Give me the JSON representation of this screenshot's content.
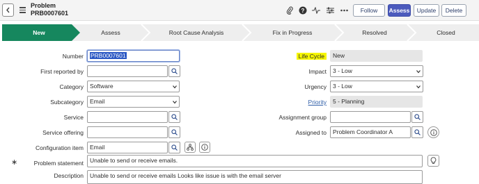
{
  "header": {
    "title": "Problem",
    "number": "PRB0007601",
    "buttons": {
      "follow": "Follow",
      "assess": "Assess",
      "update": "Update",
      "delete": "Delete"
    },
    "icons": [
      "paperclip-icon",
      "help-icon",
      "activity-icon",
      "settings-icon",
      "more-icon"
    ]
  },
  "flow": {
    "stages": [
      {
        "label": "New",
        "active": true
      },
      {
        "label": "Assess",
        "active": false
      },
      {
        "label": "Root Cause Analysis",
        "active": false
      },
      {
        "label": "Fix in Progress",
        "active": false
      },
      {
        "label": "Resolved",
        "active": false
      },
      {
        "label": "Closed",
        "active": false
      }
    ],
    "active_color": "#16875e"
  },
  "form": {
    "number": {
      "label": "Number",
      "value": "PRB0007601"
    },
    "first_reported_by": {
      "label": "First reported by",
      "value": ""
    },
    "category": {
      "label": "Category",
      "value": "Software"
    },
    "subcategory": {
      "label": "Subcategory",
      "value": "Email"
    },
    "service": {
      "label": "Service",
      "value": ""
    },
    "service_offering": {
      "label": "Service offering",
      "value": ""
    },
    "configuration_item": {
      "label": "Configuration item",
      "value": "Email"
    },
    "problem_statement": {
      "label": "Problem statement",
      "required_mark": "∗",
      "value": "Unable to send or receive emails."
    },
    "description": {
      "label": "Description",
      "value": "Unable to send or receive emails Looks like issue is with the email server"
    },
    "life_cycle": {
      "label": "Life Cycle",
      "value": "New"
    },
    "impact": {
      "label": "Impact",
      "value": "3 - Low"
    },
    "urgency": {
      "label": "Urgency",
      "value": "3 - Low"
    },
    "priority": {
      "label": "Priority",
      "value": "5 - Planning"
    },
    "assignment_group": {
      "label": "Assignment group",
      "value": ""
    },
    "assigned_to": {
      "label": "Assigned to",
      "value": "Problem Coordinator A"
    }
  }
}
